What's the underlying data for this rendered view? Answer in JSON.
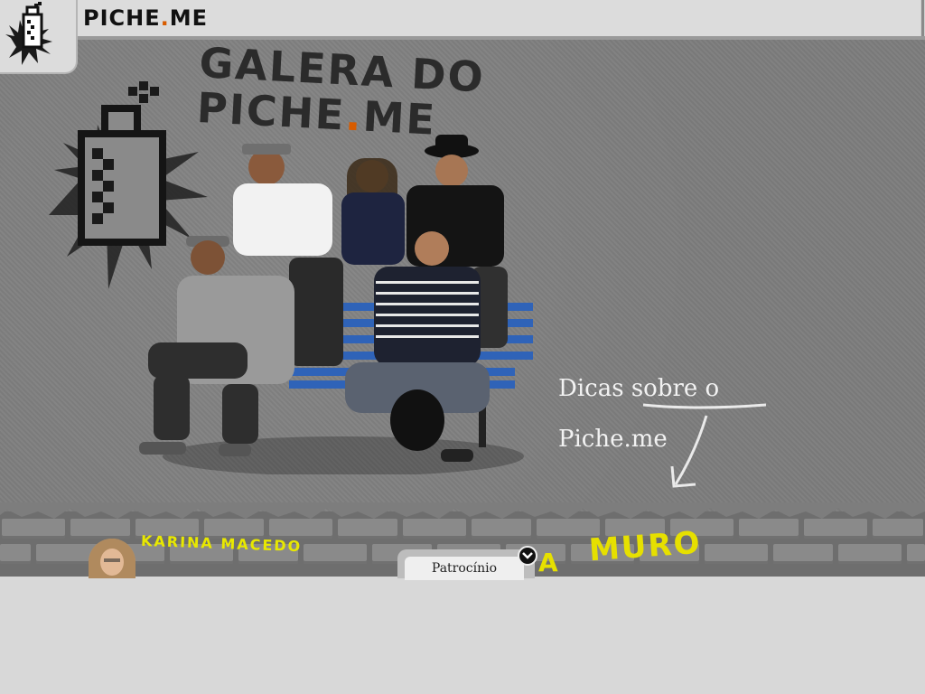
{
  "header": {
    "brand_main": "PICHE",
    "brand_dot": ".",
    "brand_tld": "ME"
  },
  "wall": {
    "title_main": "GALERA DO PICHE",
    "title_dot": ".",
    "title_tld": "ME"
  },
  "hint": {
    "line1": "Dicas sobre o",
    "line2": "Piche.me"
  },
  "footer": {
    "graffiti_name": "KARINA MACEDO",
    "graffiti_muro": "MURO",
    "graffiti_fragment": "A",
    "sponsor_tab_label": "Patrocínio"
  },
  "colors": {
    "accent_dot": "#d85c00",
    "graffiti_yellow": "#e6e000",
    "wall_gray": "#7d7d7d",
    "topbar_gray": "#dcdcdc"
  },
  "icons": {
    "logo": "spray-can-logo-icon",
    "splat": "spray-can-splat-icon",
    "toggle": "chevron-down-icon",
    "arrow": "arrow-down-left-icon"
  }
}
